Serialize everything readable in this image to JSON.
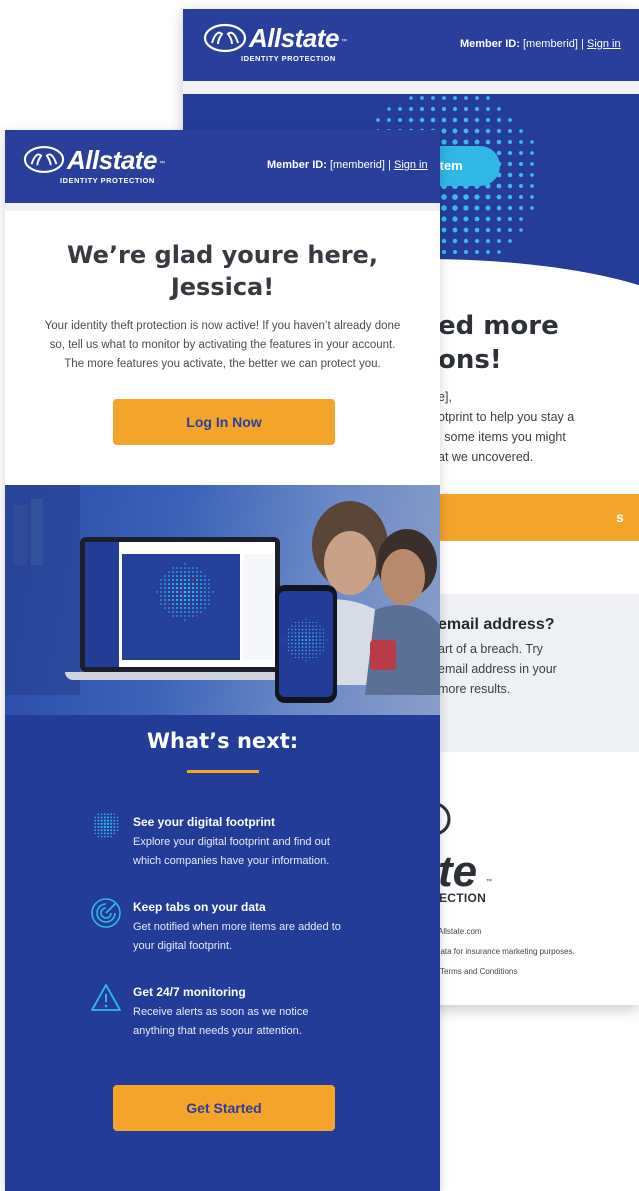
{
  "back_email": {
    "logo_text": "Allstate",
    "logo_trademark": "™",
    "logo_subtitle": "IDENTITY PROTECTION",
    "member_label": "Member ID:",
    "member_value": "[memberid]",
    "separator": "|",
    "sign_in": "Sign in",
    "hero_pill_label": "item",
    "heading_line1": "ed more",
    "heading_line2": "ons!",
    "greeting": "e],",
    "para_line1": "otprint to help you stay a",
    "para_line2": "l some items you might",
    "para_line3": "at we uncovered.",
    "button_label": "s",
    "question": "email address?",
    "q_line1": "art of a breach. Try",
    "q_line2": "email address in your",
    "q_line3": "more results.",
    "footer_logo_part": "te",
    "footer_logo_trademark": "™",
    "footer_subtitle": "ECTION",
    "footer_link1": "I  Allstate.com",
    "footer_line2": "data for insurance marketing purposes.",
    "footer_line3": "Terms and Conditions"
  },
  "front_email": {
    "logo_text": "Allstate",
    "logo_trademark": "™",
    "logo_subtitle": "IDENTITY PROTECTION",
    "member_label": "Member ID:",
    "member_value": "[memberid]",
    "separator": "|",
    "sign_in": "Sign in",
    "title_line1": "We’re glad youre here,",
    "title_line2": "Jessica!",
    "intro_line1": "Your identity theft protection is now active! If you haven’t already done",
    "intro_line2": "so, tell us what to monitor by activating the features in your account.",
    "intro_line3": "The more features you activate, the better we can protect you.",
    "login_button": "Log In Now",
    "whats_next": "What’s next:",
    "features": [
      {
        "icon": "dot-globe-icon",
        "title": "See your digital footprint",
        "line1": "Explore your digital footprint and find out",
        "line2": "which companies have your information."
      },
      {
        "icon": "radar-gauge-icon",
        "title": "Keep tabs on your data",
        "line1": "Get notified when more items are added to",
        "line2": "your digital footprint."
      },
      {
        "icon": "warning-triangle-icon",
        "title": "Get 24/7 monitoring",
        "line1": "Receive alerts as soon as we notice",
        "line2": "anything that needs your attention."
      }
    ],
    "start_button": "Get Started"
  },
  "colors": {
    "brand_blue": "#2a3f9c",
    "section_blue": "#223c98",
    "accent_orange": "#f4a42b",
    "accent_cyan": "#30b7e6"
  }
}
